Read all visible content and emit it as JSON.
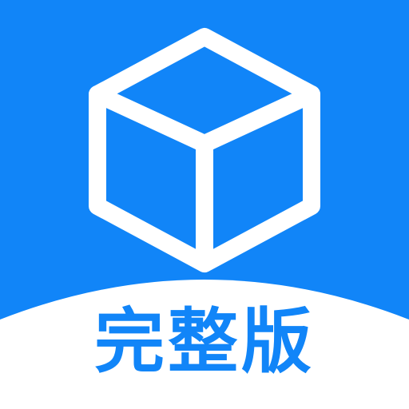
{
  "app_icon": {
    "glyph": "cube-icon",
    "label": "完整版",
    "colors": {
      "background": "#1185F8",
      "glyph": "#FFFFFF",
      "banner": "#FFFFFF",
      "label": "#1185F8"
    }
  }
}
